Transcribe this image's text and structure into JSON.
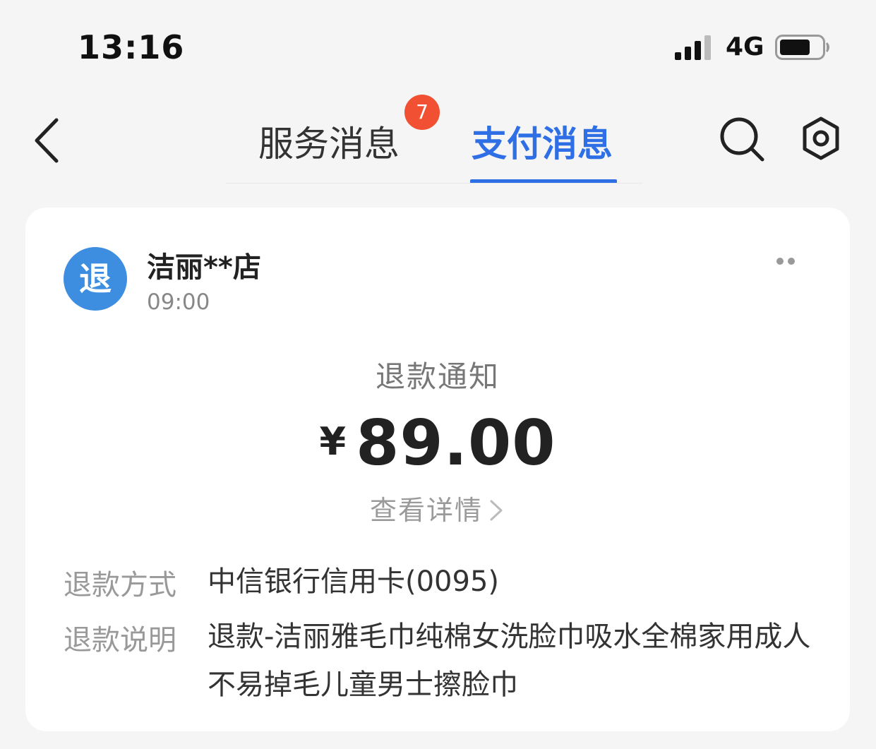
{
  "status_bar": {
    "time": "13:16",
    "network": "4G",
    "icons": [
      "signal-icon",
      "battery-icon"
    ]
  },
  "nav": {
    "back_icon": "chevron-left-icon",
    "tabs": [
      {
        "label": "服务消息",
        "badge": "7",
        "active": false
      },
      {
        "label": "支付消息",
        "active": true
      }
    ],
    "actions": [
      "search-icon",
      "gear-icon"
    ],
    "accent_color": "#2f6fe6",
    "badge_color": "#f25033"
  },
  "card": {
    "avatar_text": "退",
    "avatar_color": "#3d8ee0",
    "merchant": "洁丽**店",
    "time": "09:00",
    "more_icon": "more-dots-icon",
    "notice_title": "退款通知",
    "currency": "¥",
    "amount": "89.00",
    "detail_link": "查看详情",
    "rows": [
      {
        "label": "退款方式",
        "value": "中信银行信用卡(0095)"
      },
      {
        "label": "退款说明",
        "value": "退款-洁丽雅毛巾纯棉女洗脸巾吸水全棉家用成人不易掉毛儿童男士擦脸巾"
      }
    ]
  }
}
